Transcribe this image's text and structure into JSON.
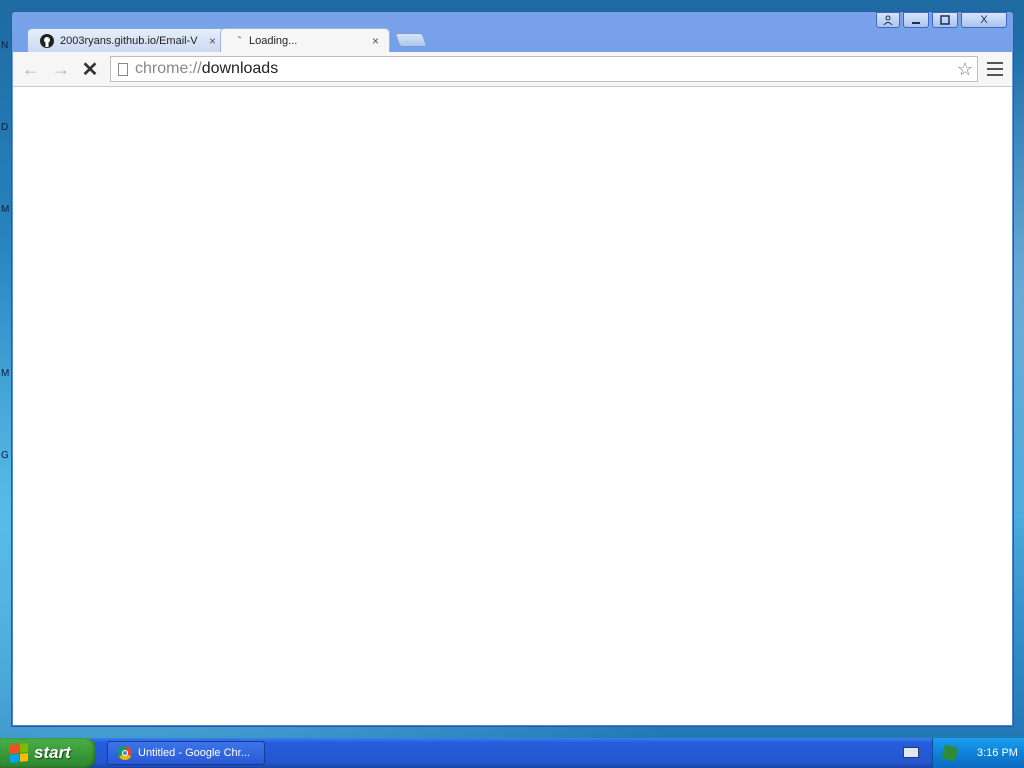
{
  "desktop": {
    "edge_letters": [
      "N",
      "D",
      "M",
      "M",
      "G"
    ]
  },
  "window": {
    "controls": {
      "user_icon": "person-icon",
      "minimize": "▬",
      "maximize": "☐",
      "close": "X"
    }
  },
  "tabs": [
    {
      "title": "2003ryans.github.io/Email-V",
      "icon": "github-icon",
      "close": "×"
    },
    {
      "title": "Loading...",
      "icon": "loading-spinner-icon",
      "close": "×"
    }
  ],
  "toolbar": {
    "back_icon": "←",
    "forward_icon": "→",
    "stop_icon": "✕",
    "url_scheme": "chrome://",
    "url_path": "downloads",
    "star_icon": "☆"
  },
  "taskbar": {
    "start_label": "start",
    "task_label": "Untitled - Google Chr...",
    "clock": "3:16 PM"
  }
}
